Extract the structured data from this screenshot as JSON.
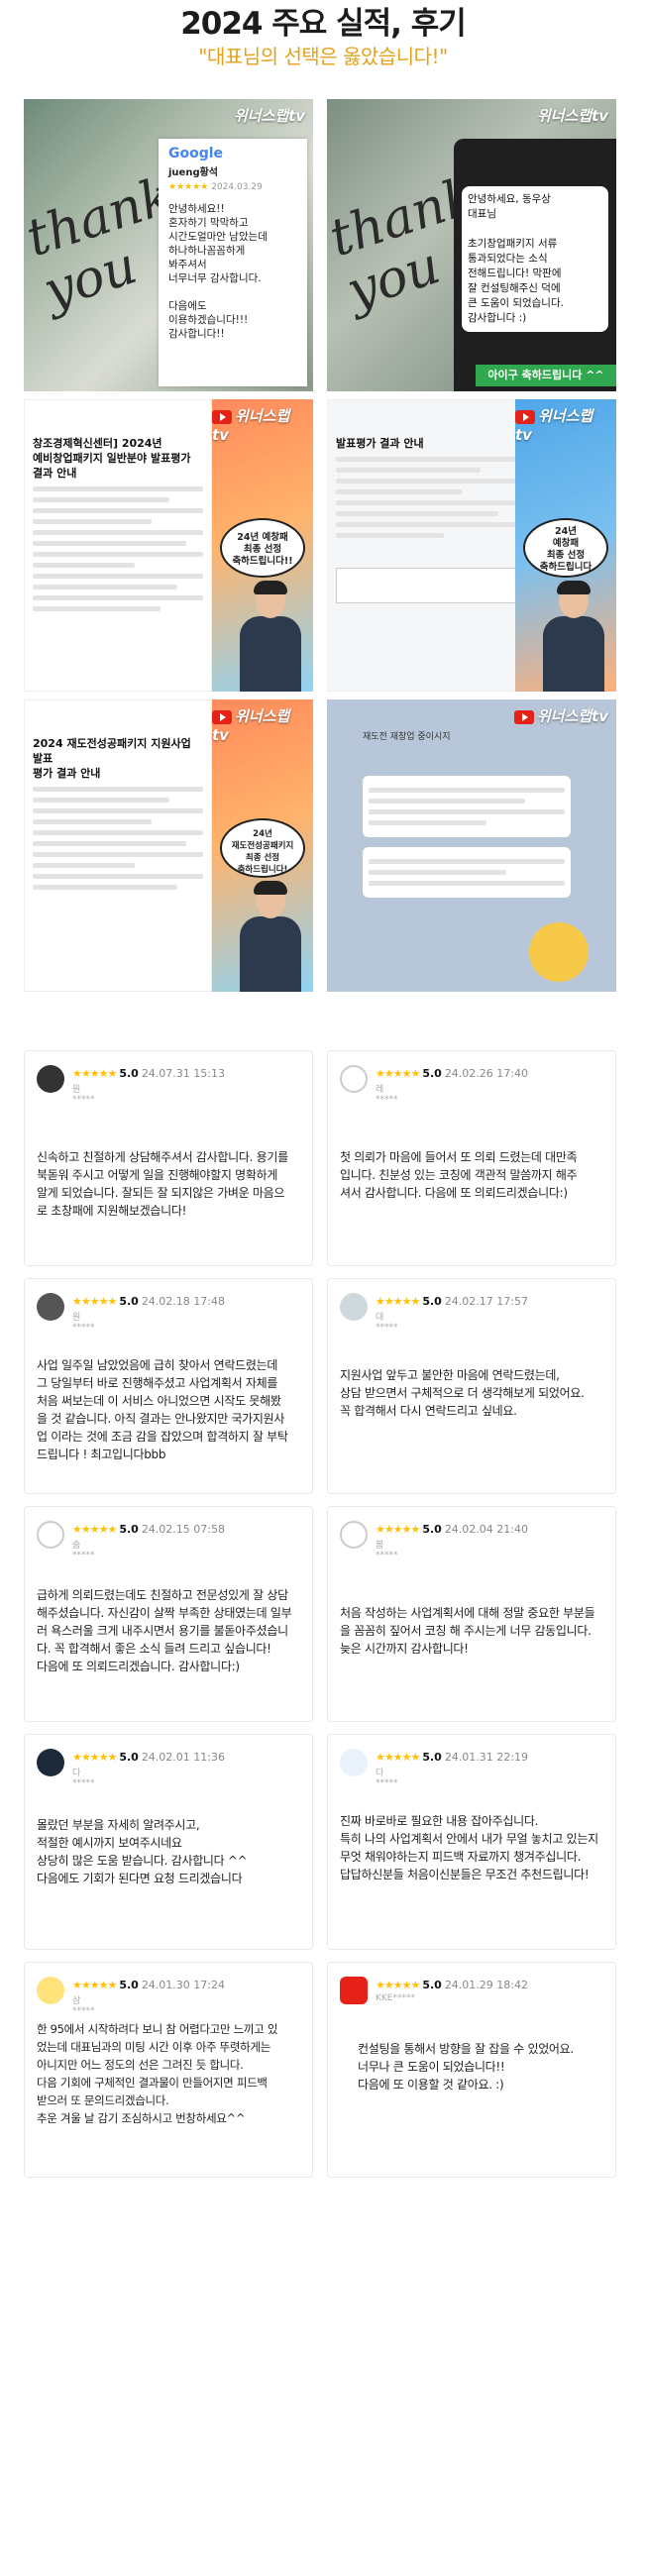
{
  "header": {
    "title": "2024 주요 실적, 후기",
    "subtitle": "\"대표님의 선택은 옳았습니다!\""
  },
  "gallery": {
    "brand": "위너스랩tv",
    "tile1": {
      "google_label": "Google",
      "reviewer": "jueng황석",
      "date": "2024.03.29",
      "text": "안녕하세요!!\n혼자하기 막막하고\n시간도얼마안 남았는데\n하나하나꼼꼼하게\n봐주셔서\n너무너무 감사합니다.\n\n다음에도\n이용하겠습니다!!!\n감사합니다!!"
    },
    "tile2": {
      "message": "안녕하세요, 동우상\n대표님\n\n초기창업패키지 서류\n통과되었다는 소식\n전해드립니다! 막판에\n잘 컨설팅해주신 덕에\n큰 도움이 되었습니다.\n감사합니다 :)",
      "banner": "아이구 축하드립니다 ^^"
    },
    "tile3": {
      "doc_title": "창조경제혁신센터] 2024년\n예비창업패키지 일반분야 발표평가\n결과 안내",
      "speech": "24년 예창패\n최종 선정\n축하드립니다!!"
    },
    "tile4": {
      "doc_title": "발표평가 결과 안내",
      "speech": "24년\n예창패\n최종 선정\n축하드립니다"
    },
    "tile5": {
      "doc_title": "2024 재도전성공패키지 지원사업 발표\n평가 결과 안내",
      "speech": "24년\n재도전성공패키지\n최종 선정\n축하드립니다!"
    },
    "tile6": {
      "chat_title": "재도전 재창업 중이시지"
    }
  },
  "reviews": [
    {
      "score": "5.0",
      "date": "24.07.31 15:13",
      "user": "원*****",
      "text": "신속하고 친절하게 상담해주셔서 감사합니다. 용기를\n북돋워 주시고 어떻게 일을 진행해야할지 명확하게\n알게 되었습니다. 잘되든 잘 되지않은 가벼운 마음으\n로 초창패에 지원해보겠습니다!"
    },
    {
      "score": "5.0",
      "date": "24.02.26 17:40",
      "user": "레*****",
      "text": "첫 의뢰가 마음에 들어서 또 의뢰 드렸는데 대만족\n입니다. 친분성 있는 코칭에 객관적 말씀까지 해주\n셔서 감사합니다. 다음에 또 의뢰드리겠습니다:)"
    },
    {
      "score": "5.0",
      "date": "24.02.18 17:48",
      "user": "원*****",
      "text": "사업 일주일 남았었음에 급히 찾아서 연락드렸는데\n그 당일부터 바로 진행해주셨고 사업계획서 자체를\n처음 써보는데 이 서비스 아니었으면 시작도 못해봤\n을 것 같습니다. 아직 결과는 안나왔지만 국가지원사\n업 이라는 것에 조금 감을 잡았으며 합격하지 잘 부탁\n드립니다 ! 최고입니다bbb"
    },
    {
      "score": "5.0",
      "date": "24.02.17 17:57",
      "user": "대*****",
      "text": "지원사업 앞두고 불안한 마음에 연락드렸는데,\n상담 받으면서 구체적으로 더 생각해보게 되었어요.\n꼭 합격해서 다시 연락드리고 싶네요."
    },
    {
      "score": "5.0",
      "date": "24.02.15 07:58",
      "user": "숨*****",
      "text": "급하게 의뢰드렸는데도 친절하고 전문성있게 잘 상담\n해주셨습니다. 자신감이 살짝 부족한 상태였는데 일부\n러 욕스러울 크게 내주시면서 용기를 불돋아주셨습니\n다. 꼭 합격해서 좋은 소식 들려 드리고 싶습니다!\n다음에 또 의뢰드리겠습니다. 감사합니다:)"
    },
    {
      "score": "5.0",
      "date": "24.02.04 21:40",
      "user": "봄*****",
      "text": "처음 작성하는 사업계획서에 대해 정말 중요한 부분들\n을 꼼꼼히 짚어서 코칭 해 주시는게 너무 감동입니다.\n늦은 시간까지 감사합니다!"
    },
    {
      "score": "5.0",
      "date": "24.02.01 11:36",
      "user": "다*****",
      "text": "몰랐던 부분을 자세히 알려주시고,\n적절한 예시까지 보여주시네요\n상당히 많은 도움 받습니다. 감사합니다 ^^\n다음에도 기회가 된다면 요청 드리겠습니다"
    },
    {
      "score": "5.0",
      "date": "24.01.31 22:19",
      "user": "다*****",
      "text": "진짜 바로바로 필요한 내용 잡아주십니다.\n특히 나의 사업계획서 안에서 내가 무얼 놓치고 있는지\n무엇 채워야하는지 피드백 자료까지 챙겨주십니다.\n답답하신분들 처음이신분들은 무조건 추천드립니다!"
    },
    {
      "score": "5.0",
      "date": "24.01.30 17:24",
      "user": "삼*****",
      "text": "한 95에서 시작하려다 보니 참 어렵다고만 느끼고 있\n었는데 대표님과의 미팅 시간 이후 아주 뚜렷하게는\n아니지만 어느 정도의 선은 그려진 듯 합니다.\n다음 기회에 구체적인 결과물이 만들어지면 피드백\n받으러 또 문의드리겠습니다.\n추운 겨울 날 감기 조심하시고 번창하세요^^"
    },
    {
      "score": "5.0",
      "date": "24.01.29 18:42",
      "user": "KKE*****",
      "text": "컨설팅을 통해서 방향을 잘 잡을 수 있었어요.\n너무나 큰 도움이 되었습니다!!\n다음에 또 이용할 것 같아요. :)"
    }
  ],
  "colors": {
    "accent": "#e3a21a",
    "star": "#ffc107"
  }
}
